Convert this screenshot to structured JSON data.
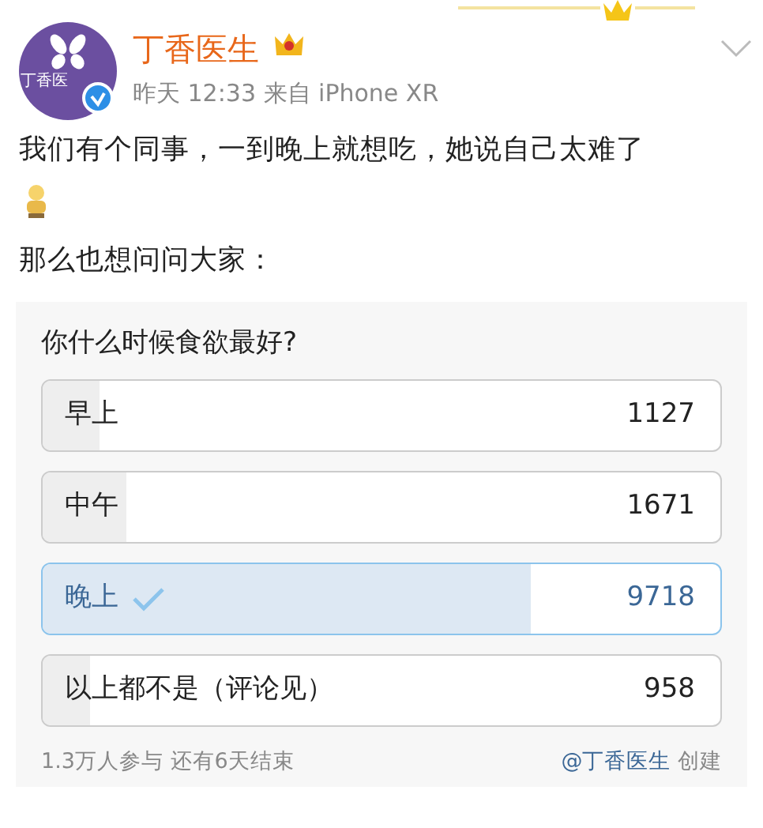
{
  "post": {
    "author": "丁香医生",
    "avatar_text": "丁香医",
    "time": "昨天 12:33",
    "source": "来自 iPhone XR",
    "text": "我们有个同事，一到晚上就想吃，她说自己太难了",
    "text2": "那么也想问问大家："
  },
  "poll": {
    "question": "你什么时候食欲最好?",
    "options": [
      {
        "label": "早上",
        "count": "1127",
        "level": 0.084,
        "selected": false
      },
      {
        "label": "中午",
        "count": "1671",
        "level": 0.124,
        "selected": false
      },
      {
        "label": "晚上",
        "count": "9718",
        "level": 0.721,
        "selected": true
      },
      {
        "label": "以上都不是（评论见）",
        "count": "958",
        "level": 0.071,
        "selected": false
      }
    ],
    "participants": "1.3万人参与",
    "remaining": "还有6天结束",
    "creator": "@丁香医生",
    "created": "创建"
  }
}
